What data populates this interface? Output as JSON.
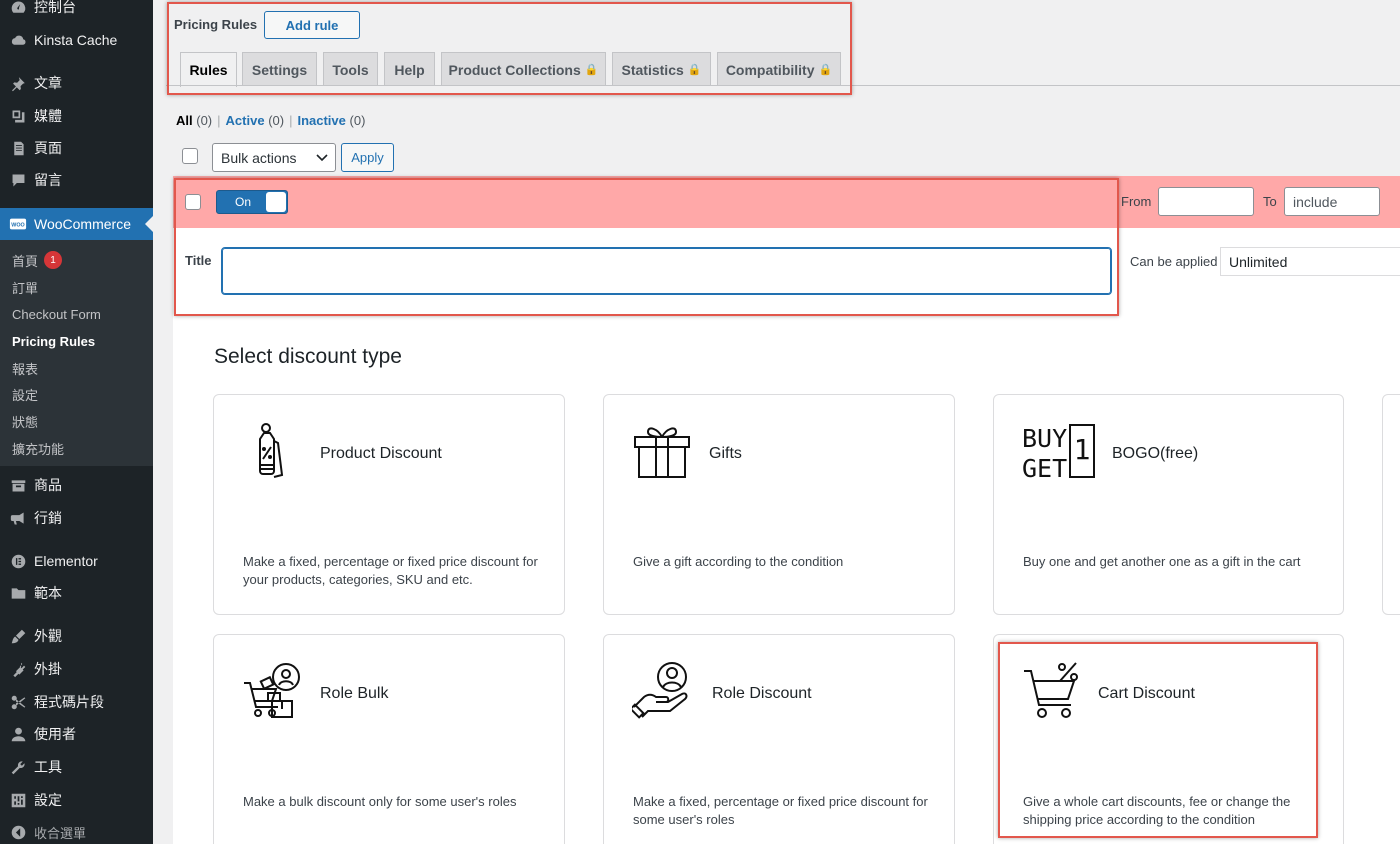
{
  "sidebar": {
    "items": [
      {
        "label": "控制台",
        "icon": "dashboard-icon"
      },
      {
        "label": "Kinsta Cache",
        "icon": "cloud-icon"
      },
      {
        "label": "文章",
        "icon": "pin-icon"
      },
      {
        "label": "媒體",
        "icon": "media-icon"
      },
      {
        "label": "頁面",
        "icon": "page-icon"
      },
      {
        "label": "留言",
        "icon": "comment-icon"
      }
    ],
    "woocommerce": {
      "label": "WooCommerce",
      "icon": "woo-icon"
    },
    "submenu": [
      {
        "label": "首頁",
        "badge": "1"
      },
      {
        "label": "訂單"
      },
      {
        "label": "Checkout Form"
      },
      {
        "label": "Pricing Rules",
        "current": true
      },
      {
        "label": "報表"
      },
      {
        "label": "設定"
      },
      {
        "label": "狀態"
      },
      {
        "label": "擴充功能"
      }
    ],
    "items_after": [
      {
        "label": "商品",
        "icon": "archive-icon"
      },
      {
        "label": "行銷",
        "icon": "megaphone-icon"
      },
      {
        "label": "Elementor",
        "icon": "elementor-icon"
      },
      {
        "label": "範本",
        "icon": "folder-icon"
      },
      {
        "label": "外觀",
        "icon": "brush-icon"
      },
      {
        "label": "外掛",
        "icon": "plug-icon"
      },
      {
        "label": "程式碼片段",
        "icon": "scissors-icon"
      },
      {
        "label": "使用者",
        "icon": "user-icon"
      },
      {
        "label": "工具",
        "icon": "wrench-icon"
      },
      {
        "label": "設定",
        "icon": "settings-icon"
      },
      {
        "label": "收合選單",
        "icon": "collapse-icon"
      }
    ]
  },
  "header": {
    "title": "Pricing Rules",
    "add_rule": "Add rule",
    "tabs": [
      {
        "label": "Rules",
        "active": true,
        "locked": false
      },
      {
        "label": "Settings",
        "locked": false
      },
      {
        "label": "Tools",
        "locked": false
      },
      {
        "label": "Help",
        "locked": false
      },
      {
        "label": "Product Collections",
        "locked": true
      },
      {
        "label": "Statistics",
        "locked": true
      },
      {
        "label": "Compatibility",
        "locked": true
      }
    ]
  },
  "filters": {
    "all": "All",
    "all_count": "(0)",
    "active": "Active",
    "active_count": "(0)",
    "inactive": "Inactive",
    "inactive_count": "(0)"
  },
  "bulk": {
    "selected": "Bulk actions",
    "apply": "Apply"
  },
  "rule": {
    "toggle": "On",
    "from_label": "From",
    "to_label": "To",
    "to_value": "include",
    "title_label": "Title",
    "title_value": "",
    "can_apply_label": "Can be applied",
    "can_apply_value": "Unlimited"
  },
  "discount": {
    "heading": "Select discount type",
    "cards": [
      {
        "title": "Product Discount",
        "desc": "Make a fixed, percentage or fixed price discount for your products, categories, SKU and etc.",
        "icon": "price-tag-icon"
      },
      {
        "title": "Gifts",
        "desc": "Give a gift according to the condition",
        "icon": "gift-icon"
      },
      {
        "title": "BOGO(free)",
        "desc": "Buy one and get another one as a gift in the cart",
        "icon": "buy-get-one-icon",
        "icon_text_1": "BUY",
        "icon_text_2": "GET",
        "icon_text_3": "1"
      },
      {
        "title": "Role Bulk",
        "desc": "Make a bulk discount only for some user's roles",
        "icon": "cart-user-icon"
      },
      {
        "title": "Role Discount",
        "desc": "Make a fixed, percentage or fixed price discount for some user's roles",
        "icon": "hand-user-icon"
      },
      {
        "title": "Cart Discount",
        "desc": "Give a whole cart discounts, fee or change the shipping price according to the condition",
        "icon": "cart-percent-icon"
      }
    ]
  }
}
